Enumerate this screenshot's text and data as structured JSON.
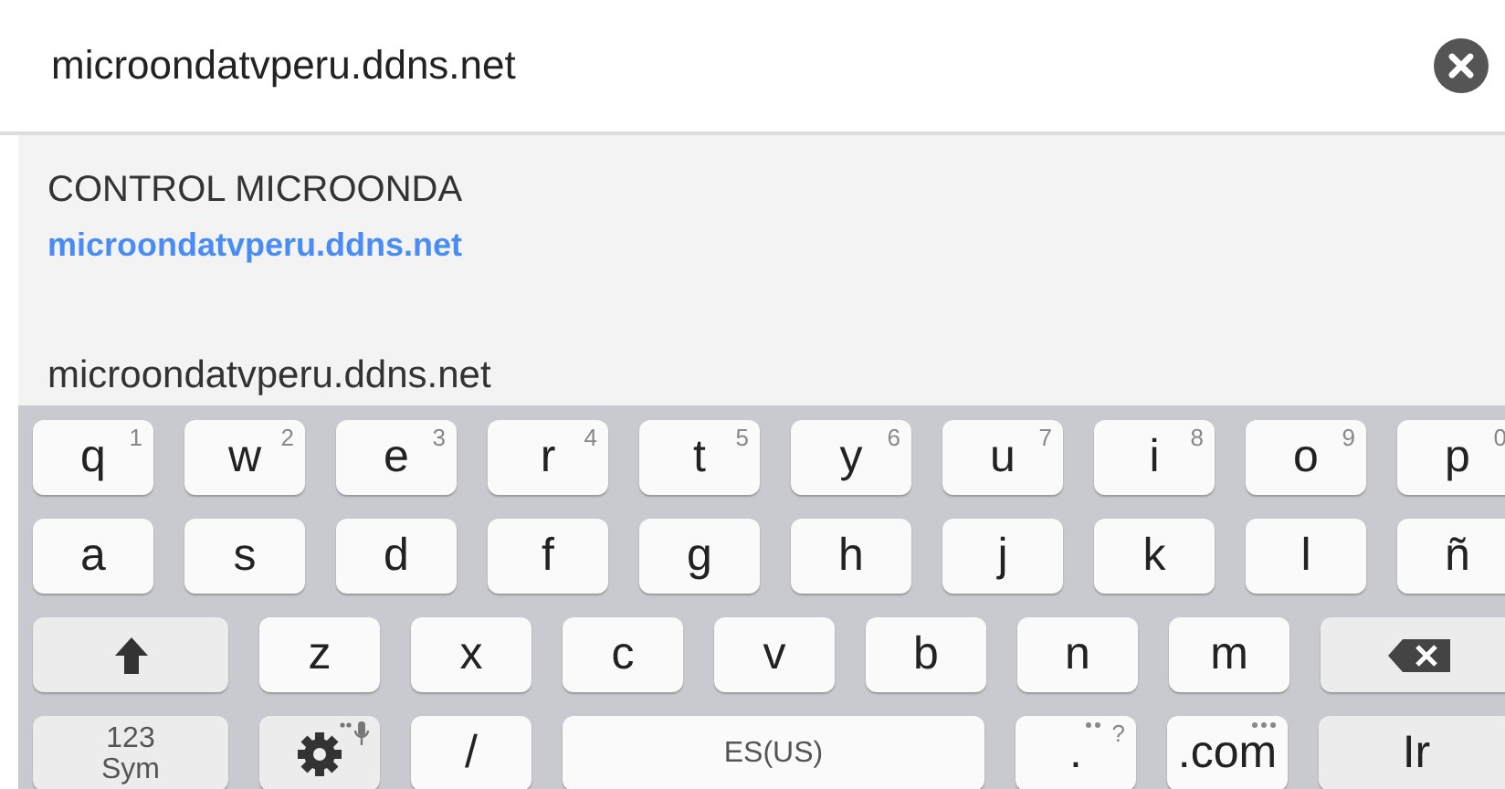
{
  "search": {
    "value": "microondatvperu.ddns.net"
  },
  "suggestions": [
    {
      "kind": "titled",
      "title": "CONTROL MICROONDA",
      "url": "microondatvperu.ddns.net"
    },
    {
      "kind": "plain",
      "title": "microondatvperu.ddns.net"
    }
  ],
  "keyboard": {
    "rows": [
      [
        {
          "kind": "char",
          "label": "q",
          "hint": "1"
        },
        {
          "kind": "char",
          "label": "w",
          "hint": "2"
        },
        {
          "kind": "char",
          "label": "e",
          "hint": "3"
        },
        {
          "kind": "char",
          "label": "r",
          "hint": "4"
        },
        {
          "kind": "char",
          "label": "t",
          "hint": "5"
        },
        {
          "kind": "char",
          "label": "y",
          "hint": "6"
        },
        {
          "kind": "char",
          "label": "u",
          "hint": "7"
        },
        {
          "kind": "char",
          "label": "i",
          "hint": "8"
        },
        {
          "kind": "char",
          "label": "o",
          "hint": "9"
        },
        {
          "kind": "char",
          "label": "p",
          "hint": "0"
        }
      ],
      [
        {
          "kind": "char",
          "label": "a"
        },
        {
          "kind": "char",
          "label": "s"
        },
        {
          "kind": "char",
          "label": "d"
        },
        {
          "kind": "char",
          "label": "f"
        },
        {
          "kind": "char",
          "label": "g"
        },
        {
          "kind": "char",
          "label": "h"
        },
        {
          "kind": "char",
          "label": "j"
        },
        {
          "kind": "char",
          "label": "k"
        },
        {
          "kind": "char",
          "label": "l"
        },
        {
          "kind": "char",
          "label": "ñ"
        }
      ],
      [
        {
          "kind": "shift"
        },
        {
          "kind": "char",
          "label": "z"
        },
        {
          "kind": "char",
          "label": "x"
        },
        {
          "kind": "char",
          "label": "c"
        },
        {
          "kind": "char",
          "label": "v"
        },
        {
          "kind": "char",
          "label": "b"
        },
        {
          "kind": "char",
          "label": "n"
        },
        {
          "kind": "char",
          "label": "m"
        },
        {
          "kind": "backspace"
        }
      ],
      [
        {
          "kind": "sym",
          "label": "123",
          "label2": "Sym"
        },
        {
          "kind": "settings"
        },
        {
          "kind": "char",
          "label": "/"
        },
        {
          "kind": "space",
          "label": "ES(US)"
        },
        {
          "kind": "char",
          "label": ".",
          "hint": "?",
          "more": true
        },
        {
          "kind": "char",
          "label": ".com",
          "more": true
        },
        {
          "kind": "func",
          "label": "Ir"
        }
      ]
    ]
  }
}
